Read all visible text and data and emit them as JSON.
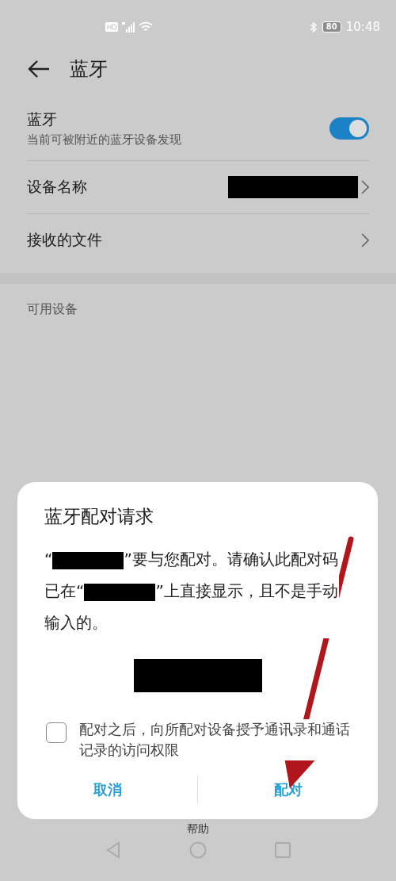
{
  "status_bar": {
    "battery": "80",
    "time": "10:48"
  },
  "header": {
    "title": "蓝牙"
  },
  "settings": [
    {
      "kind": "toggle",
      "label": "蓝牙",
      "subtitle": "当前可被附近的蓝牙设备发现",
      "on": true
    },
    {
      "kind": "redacted-link",
      "label": "设备名称"
    },
    {
      "kind": "link",
      "label": "接收的文件"
    }
  ],
  "section": {
    "label": "可用设备"
  },
  "bottom_bar": {
    "label": "帮助"
  },
  "dialog": {
    "title": "蓝牙配对请求",
    "message": [
      {
        "kind": "text",
        "text": "“"
      },
      {
        "kind": "redacted"
      },
      {
        "kind": "text",
        "text": "”要与您配对。请确认此配对码已在“"
      },
      {
        "kind": "redacted"
      },
      {
        "kind": "text",
        "text": "”上直接显示，且不是手动输入的。"
      }
    ],
    "checkbox": {
      "label": "配对之后，向所配对设备授予通讯录和通话记录的访问权限",
      "checked": false
    },
    "buttons": [
      "取消",
      "配对"
    ]
  }
}
